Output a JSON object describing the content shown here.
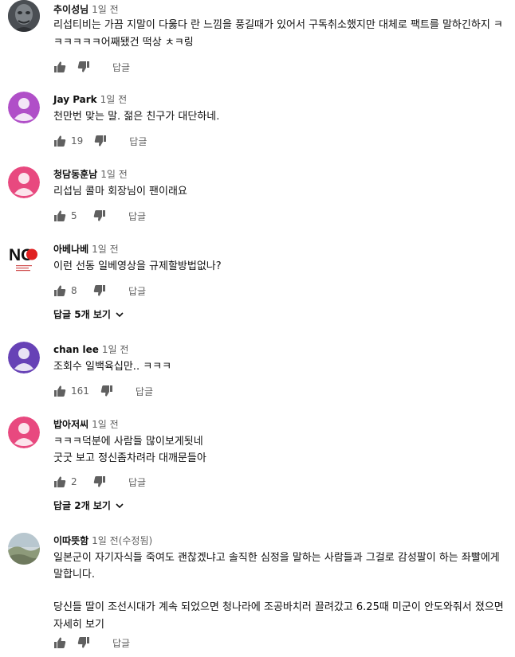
{
  "reply_label": "답글",
  "comments": [
    {
      "author": "추이성님",
      "time": "1일 전",
      "lines": [
        "리섭티비는 가끔 지말이 다욿다 란 느낌을 풍길때가 있어서 구독취소했지만 대체로 팩트를 말하긴하지 ㅋ",
        "ㅋㅋㅋㅋㅋ어째됐건 떡상 ㅊㅋ링"
      ],
      "likes": ""
    },
    {
      "author": "Jay Park",
      "time": "1일 전",
      "lines": [
        "천만번 맞는 말. 젊은 친구가 대단하네."
      ],
      "likes": "19",
      "avatar_color": "#b04fc8"
    },
    {
      "author": "청담동훈남",
      "time": "1일 전",
      "lines": [
        "리섭님 콜마 회장님이 팬이래요"
      ],
      "likes": "5",
      "avatar_color": "#e8497f"
    },
    {
      "author": "아베나베",
      "time": "1일 전",
      "lines": [
        "이런 선동 일베영상을 규제할방법없나?"
      ],
      "likes": "8",
      "avatar_logo": "NO",
      "replies": "답글 5개 보기"
    },
    {
      "author": "chan lee",
      "time": "1일 전",
      "lines": [
        "조회수 일백육십만.. ㅋㅋㅋ"
      ],
      "likes": "161",
      "avatar_color": "#6742b6"
    },
    {
      "author": "밥아저씨",
      "time": "1일 전",
      "lines": [
        "ㅋㅋㅋ덕분에 사람들 많이보게됫네",
        "굿굿 보고 정신좀차려라 대깨문들아"
      ],
      "likes": "2",
      "avatar_color": "#e8497f",
      "replies": "답글 2개 보기"
    },
    {
      "author": "이따뜻함",
      "time": "1일 전(수정됨)",
      "lines": [
        "일본군이 자기자식들 죽여도 괜찮겠냐고 솔직한 심정을 말하는 사람들과 그걸로 감성팔이 하는 좌빨에게",
        "말합니다.",
        "",
        "당신들 딸이 조선시대가 계속 되었으면 청나라에 조공바치러 끌려갔고 6.25때 미군이 안도와줘서 졌으면"
      ],
      "likes": "",
      "read_more": "자세히 보기"
    }
  ]
}
